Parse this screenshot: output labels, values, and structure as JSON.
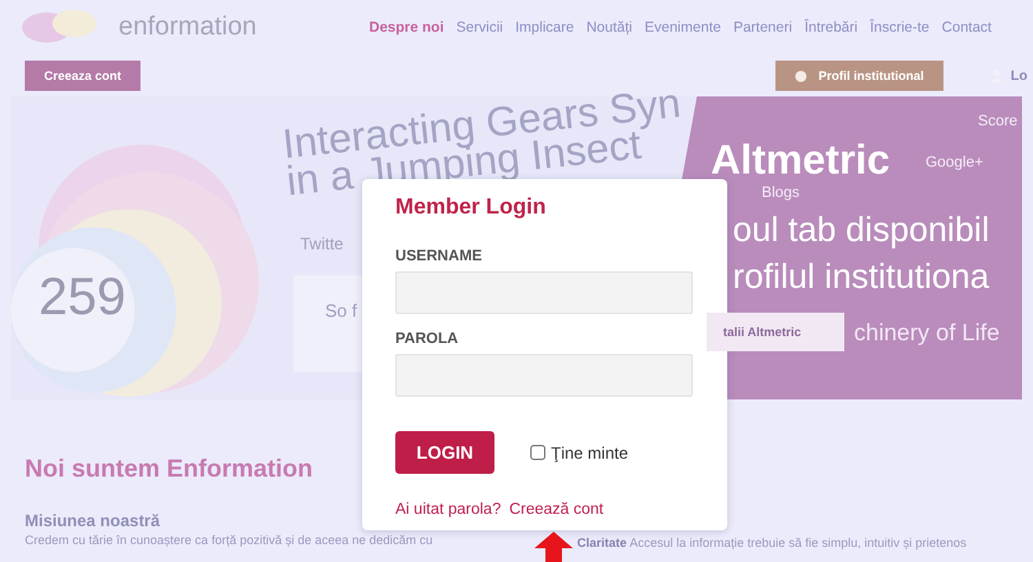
{
  "header": {
    "logo": "enformation",
    "nav": [
      {
        "label": "Despre noi",
        "selected": true
      },
      {
        "label": "Servicii",
        "selected": false
      },
      {
        "label": "Implicare",
        "selected": false
      },
      {
        "label": "Noutăți",
        "selected": false
      },
      {
        "label": "Evenimente",
        "selected": false
      },
      {
        "label": "Parteneri",
        "selected": false
      },
      {
        "label": "Întrebări",
        "selected": false
      },
      {
        "label": "Înscrie-te",
        "selected": false
      },
      {
        "label": "Contact",
        "selected": false
      }
    ]
  },
  "toolbar": {
    "create_account": "Creeaza cont",
    "institutional_profile": "Profil institutional",
    "login": "Lo"
  },
  "hero": {
    "headline_lines": [
      "Interacting Gears Syn",
      "in a Jumping Insect"
    ],
    "score": "259",
    "source_label": "Twitte",
    "snippet": "So f",
    "sources": [
      "Google+",
      "Blogs",
      "Score"
    ],
    "brand": "Altmetric",
    "tagline_lines": [
      "oul tab disponibil",
      "rofilul institutiona"
    ],
    "details_button": "talii Altmetric",
    "caption": "chinery of Life"
  },
  "about": {
    "title": "Noi suntem Enformation",
    "subtitle": "Misiunea noastră",
    "text": "Credem cu tărie în cunoaștere ca forță pozitivă și de aceea ne dedicăm cu",
    "value": "**Claritate** Accesul la informație trebuie să fie simplu, intuitiv și prietenos"
  },
  "modal": {
    "title": "Member Login",
    "fields": [
      {
        "label": "USERNAME"
      },
      {
        "label": "PAROLA"
      }
    ],
    "login_button": "LOGIN",
    "remember": {
      "label": "Ţine minte",
      "checked": false
    },
    "links": [
      "Ai uitat parola?",
      "Creează cont"
    ]
  }
}
